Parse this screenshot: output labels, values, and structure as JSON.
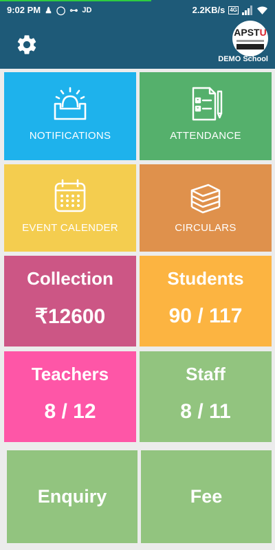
{
  "status_bar": {
    "time": "9:02 PM",
    "carrier": "JD",
    "network_speed": "2.2KB/s",
    "network_type": "4G",
    "progress": 0.55,
    "icons": [
      "ant-icon",
      "whatsapp-icon",
      "vowifi-icon",
      "signal-icon",
      "wifi-icon"
    ]
  },
  "header": {
    "settings_icon": "gear-icon",
    "logo": {
      "text_main": "APST",
      "text_accent": "U"
    },
    "school_name": "DEMO School"
  },
  "menu": {
    "notifications": {
      "label": "NOTIFICATIONS",
      "icon": "bell-icon",
      "color": "#1eb2ec"
    },
    "attendance": {
      "label": "ATTENDANCE",
      "icon": "checklist-icon",
      "color": "#55b06c"
    },
    "event_calendar": {
      "label": "EVENT CALENDER",
      "icon": "calendar-icon",
      "color": "#f4cd4f"
    },
    "circulars": {
      "label": "CIRCULARS",
      "icon": "stack-icon",
      "color": "#df914c"
    }
  },
  "stats": {
    "collection": {
      "title": "Collection",
      "value": "₹12600",
      "color": "#cc5685"
    },
    "students": {
      "title": "Students",
      "value": "90 / 117",
      "color": "#fcb441"
    },
    "teachers": {
      "title": "Teachers",
      "value": "8 / 12",
      "color": "#fe56a7"
    },
    "staff": {
      "title": "Staff",
      "value": "8 / 11",
      "color": "#92c47f"
    }
  },
  "actions": {
    "enquiry": {
      "title": "Enquiry",
      "color": "#92c47f"
    },
    "fee": {
      "title": "Fee",
      "color": "#92c47f"
    }
  }
}
